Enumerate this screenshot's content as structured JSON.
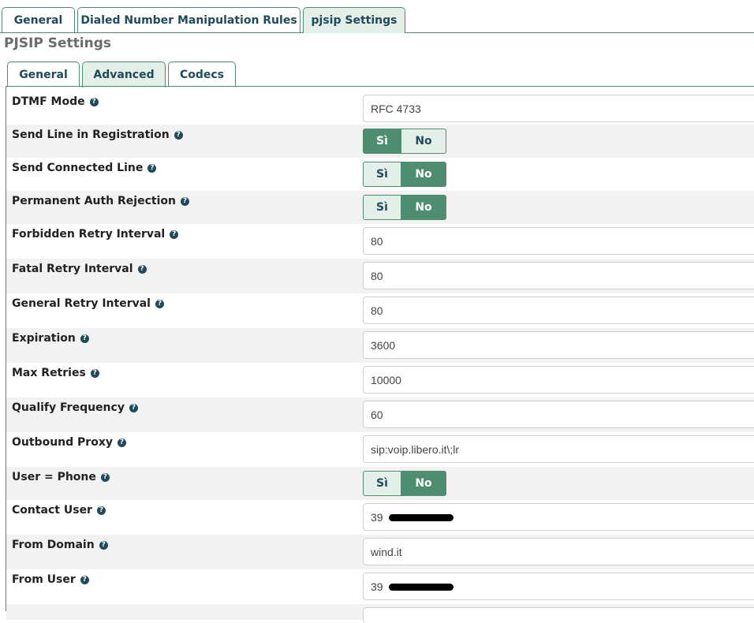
{
  "top_tabs": [
    {
      "label": "General"
    },
    {
      "label": "Dialed Number Manipulation Rules"
    },
    {
      "label": "pjsip Settings",
      "active": true
    }
  ],
  "section_title": "PJSIP Settings",
  "sub_tabs": [
    {
      "label": "General"
    },
    {
      "label": "Advanced",
      "active": true
    },
    {
      "label": "Codecs"
    }
  ],
  "help_icon_glyph": "?",
  "toggle_labels": {
    "yes": "Sì",
    "no": "No"
  },
  "rows": [
    {
      "label": "DTMF Mode",
      "type": "input",
      "value": "RFC 4733"
    },
    {
      "label": "Send Line in Registration",
      "type": "toggle",
      "selected": "yes"
    },
    {
      "label": "Send Connected Line",
      "type": "toggle",
      "selected": "no"
    },
    {
      "label": "Permanent Auth Rejection",
      "type": "toggle",
      "selected": "no"
    },
    {
      "label": "Forbidden Retry Interval",
      "type": "input",
      "value": "80"
    },
    {
      "label": "Fatal Retry Interval",
      "type": "input",
      "value": "80"
    },
    {
      "label": "General Retry Interval",
      "type": "input",
      "value": "80"
    },
    {
      "label": "Expiration",
      "type": "input",
      "value": "3600"
    },
    {
      "label": "Max Retries",
      "type": "input",
      "value": "10000"
    },
    {
      "label": "Qualify Frequency",
      "type": "input",
      "value": "60"
    },
    {
      "label": "Outbound Proxy",
      "type": "input",
      "value": "sip:voip.libero.it\\;lr"
    },
    {
      "label": "User = Phone",
      "type": "toggle",
      "selected": "no"
    },
    {
      "label": "Contact User",
      "type": "input",
      "value": "39",
      "redacted": true
    },
    {
      "label": "From Domain",
      "type": "input",
      "value": "wind.it"
    },
    {
      "label": "From User",
      "type": "input",
      "value": "39",
      "redacted": true
    }
  ],
  "colors": {
    "accent": "#4e8d70",
    "tab_active_bg": "#e4efe9",
    "tab_text": "#1e4a5a",
    "row_alt_bg": "#f2f2f2"
  }
}
